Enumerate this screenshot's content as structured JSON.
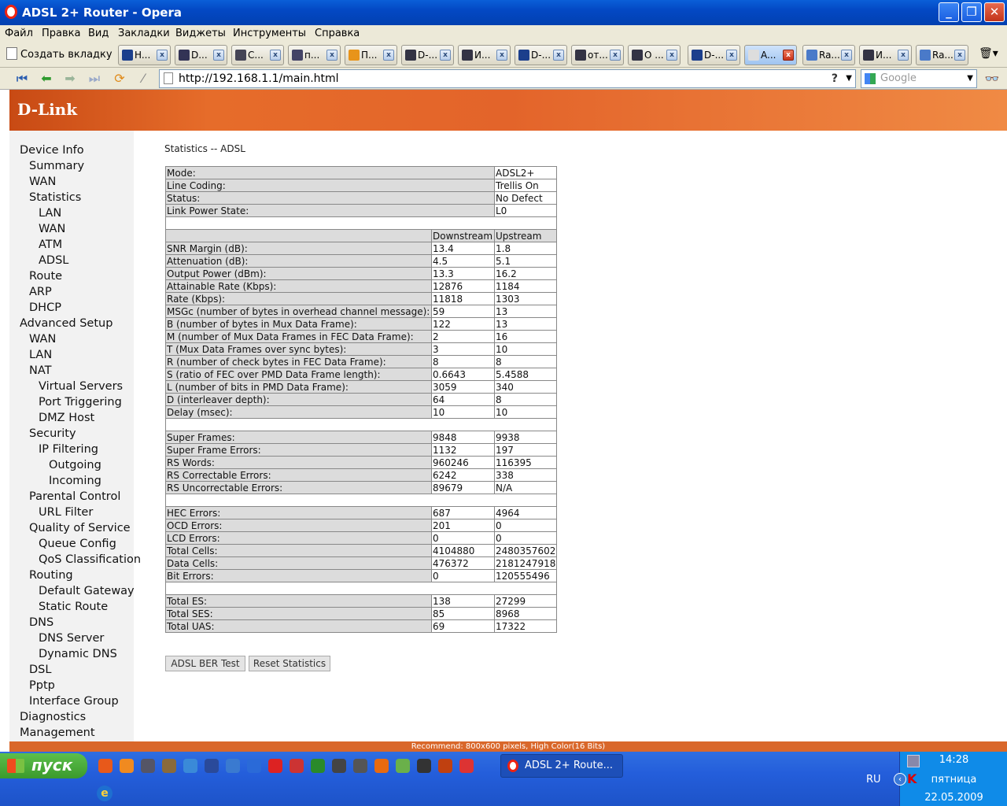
{
  "window": {
    "title": "ADSL 2+ Router - Opera"
  },
  "menu": [
    "Файл",
    "Правка",
    "Вид",
    "Закладки",
    "Виджеты",
    "Инструменты",
    "Справка"
  ],
  "tabs": {
    "new_tab": "Создать вкладку",
    "items": [
      {
        "label": "H..."
      },
      {
        "label": "D..."
      },
      {
        "label": "C..."
      },
      {
        "label": "п..."
      },
      {
        "label": "П..."
      },
      {
        "label": "D-..."
      },
      {
        "label": "И..."
      },
      {
        "label": "D-..."
      },
      {
        "label": "от..."
      },
      {
        "label": "О ..."
      },
      {
        "label": "D-..."
      },
      {
        "label": "A...",
        "active": true
      },
      {
        "label": "Ra..."
      },
      {
        "label": "И..."
      },
      {
        "label": "Ra..."
      }
    ]
  },
  "address": {
    "url": "http://192.168.1.1/main.html",
    "search_placeholder": "Google"
  },
  "brand": {
    "logo": "D-Link"
  },
  "sidebar": {
    "items": [
      {
        "label": "Device Info",
        "level": 0
      },
      {
        "label": "Summary",
        "level": 1
      },
      {
        "label": "WAN",
        "level": 1
      },
      {
        "label": "Statistics",
        "level": 1
      },
      {
        "label": "LAN",
        "level": 2
      },
      {
        "label": "WAN",
        "level": 2
      },
      {
        "label": "ATM",
        "level": 2
      },
      {
        "label": "ADSL",
        "level": 2
      },
      {
        "label": "Route",
        "level": 1
      },
      {
        "label": "ARP",
        "level": 1
      },
      {
        "label": "DHCP",
        "level": 1
      },
      {
        "label": "Advanced Setup",
        "level": 0
      },
      {
        "label": "WAN",
        "level": 1
      },
      {
        "label": "LAN",
        "level": 1
      },
      {
        "label": "NAT",
        "level": 1
      },
      {
        "label": "Virtual Servers",
        "level": 2
      },
      {
        "label": "Port Triggering",
        "level": 2
      },
      {
        "label": "DMZ Host",
        "level": 2
      },
      {
        "label": "Security",
        "level": 1
      },
      {
        "label": "IP Filtering",
        "level": 2
      },
      {
        "label": "Outgoing",
        "level": 3
      },
      {
        "label": "Incoming",
        "level": 3
      },
      {
        "label": "Parental Control",
        "level": 1
      },
      {
        "label": "URL Filter",
        "level": 2
      },
      {
        "label": "Quality of Service",
        "level": 1
      },
      {
        "label": "Queue Config",
        "level": 2
      },
      {
        "label": "QoS Classification",
        "level": 2
      },
      {
        "label": "Routing",
        "level": 1
      },
      {
        "label": "Default Gateway",
        "level": 2
      },
      {
        "label": "Static Route",
        "level": 2
      },
      {
        "label": "DNS",
        "level": 1
      },
      {
        "label": "DNS Server",
        "level": 2
      },
      {
        "label": "Dynamic DNS",
        "level": 2
      },
      {
        "label": "DSL",
        "level": 1
      },
      {
        "label": "Pptp",
        "level": 1
      },
      {
        "label": "Interface Group",
        "level": 1
      },
      {
        "label": "Diagnostics",
        "level": 0
      },
      {
        "label": "Management",
        "level": 0
      }
    ]
  },
  "page": {
    "title": "Statistics -- ADSL",
    "status_rows": [
      {
        "label": "Mode:",
        "value": "ADSL2+"
      },
      {
        "label": "Line Coding:",
        "value": "Trellis On"
      },
      {
        "label": "Status:",
        "value": "No Defect"
      },
      {
        "label": "Link Power State:",
        "value": "L0"
      }
    ],
    "columns": {
      "down": "Downstream",
      "up": "Upstream"
    },
    "sections": [
      [
        {
          "label": "SNR Margin (dB):",
          "down": "13.4",
          "up": "1.8"
        },
        {
          "label": "Attenuation (dB):",
          "down": "4.5",
          "up": "5.1"
        },
        {
          "label": "Output Power (dBm):",
          "down": "13.3",
          "up": "16.2"
        },
        {
          "label": "Attainable Rate (Kbps):",
          "down": "12876",
          "up": "1184"
        },
        {
          "label": "Rate (Kbps):",
          "down": "11818",
          "up": "1303"
        },
        {
          "label": "MSGc (number of bytes in overhead channel message):",
          "down": "59",
          "up": "13"
        },
        {
          "label": "B (number of bytes in Mux Data Frame):",
          "down": "122",
          "up": "13"
        },
        {
          "label": "M (number of Mux Data Frames in FEC Data Frame):",
          "down": "2",
          "up": "16"
        },
        {
          "label": "T (Mux Data Frames over sync bytes):",
          "down": "3",
          "up": "10"
        },
        {
          "label": "R (number of check bytes in FEC Data Frame):",
          "down": "8",
          "up": "8"
        },
        {
          "label": "S (ratio of FEC over PMD Data Frame length):",
          "down": "0.6643",
          "up": "5.4588"
        },
        {
          "label": "L (number of bits in PMD Data Frame):",
          "down": "3059",
          "up": "340"
        },
        {
          "label": "D (interleaver depth):",
          "down": "64",
          "up": "8"
        },
        {
          "label": "Delay (msec):",
          "down": "10",
          "up": "10"
        }
      ],
      [
        {
          "label": "Super Frames:",
          "down": "9848",
          "up": "9938"
        },
        {
          "label": "Super Frame Errors:",
          "down": "1132",
          "up": "197"
        },
        {
          "label": "RS Words:",
          "down": "960246",
          "up": "116395"
        },
        {
          "label": "RS Correctable Errors:",
          "down": "6242",
          "up": "338"
        },
        {
          "label": "RS Uncorrectable Errors:",
          "down": "89679",
          "up": "N/A"
        }
      ],
      [
        {
          "label": "HEC Errors:",
          "down": "687",
          "up": "4964"
        },
        {
          "label": "OCD Errors:",
          "down": "201",
          "up": "0"
        },
        {
          "label": "LCD Errors:",
          "down": "0",
          "up": "0"
        },
        {
          "label": "Total Cells:",
          "down": "4104880",
          "up": "2480357602"
        },
        {
          "label": "Data Cells:",
          "down": "476372",
          "up": "2181247918"
        },
        {
          "label": "Bit Errors:",
          "down": "0",
          "up": "120555496"
        }
      ],
      [
        {
          "label": "Total ES:",
          "down": "138",
          "up": "27299"
        },
        {
          "label": "Total SES:",
          "down": "85",
          "up": "8968"
        },
        {
          "label": "Total UAS:",
          "down": "69",
          "up": "17322"
        }
      ]
    ],
    "buttons": {
      "ber": "ADSL BER Test",
      "reset": "Reset Statistics"
    },
    "footer": "Recommend: 800x600 pixels, High Color(16 Bits)"
  },
  "taskbar": {
    "start": "пуск",
    "task": "ADSL 2+ Route...",
    "lang": "RU",
    "time": "14:28",
    "day": "пятница",
    "date": "22.05.2009"
  }
}
